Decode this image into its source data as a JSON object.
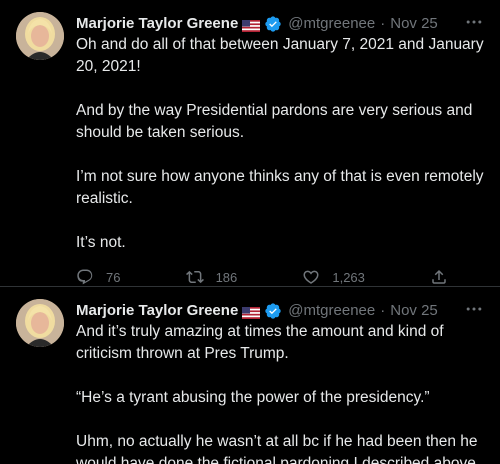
{
  "tweets": [
    {
      "author": {
        "name": "Marjorie Taylor Greene",
        "flag": "us-flag-icon",
        "verified": true,
        "handle": "@mtgreenee",
        "separator": "·",
        "date": "Nov 25"
      },
      "text": "Oh and do all of that between January 7, 2021 and January 20, 2021!\n\nAnd by the way Presidential pardons are very serious and should be taken serious.\n\nI’m not sure how anyone thinks any of that is even remotely realistic.\n\nIt’s not.",
      "actions": {
        "replies": "76",
        "retweets": "186",
        "likes": "1,263"
      }
    },
    {
      "author": {
        "name": "Marjorie Taylor Greene",
        "flag": "us-flag-icon",
        "verified": true,
        "handle": "@mtgreenee",
        "separator": "·",
        "date": "Nov 25"
      },
      "text": "And it’s truly amazing at times the amount and kind of criticism thrown at Pres Trump.\n\n“He’s a tyrant abusing the power of the presidency.”\n\nUhm, no actually he wasn’t at all bc if he had been then he would have done the fictional pardoning I described above."
    }
  ],
  "colors": {
    "background": "#000000",
    "text": "#e7e9ea",
    "secondary": "#71767b",
    "verified": "#1d9bf0",
    "divider": "#2f3336"
  },
  "icons": [
    "reply-icon",
    "retweet-icon",
    "like-icon",
    "share-icon",
    "more-icon",
    "verified-icon",
    "us-flag-icon"
  ]
}
